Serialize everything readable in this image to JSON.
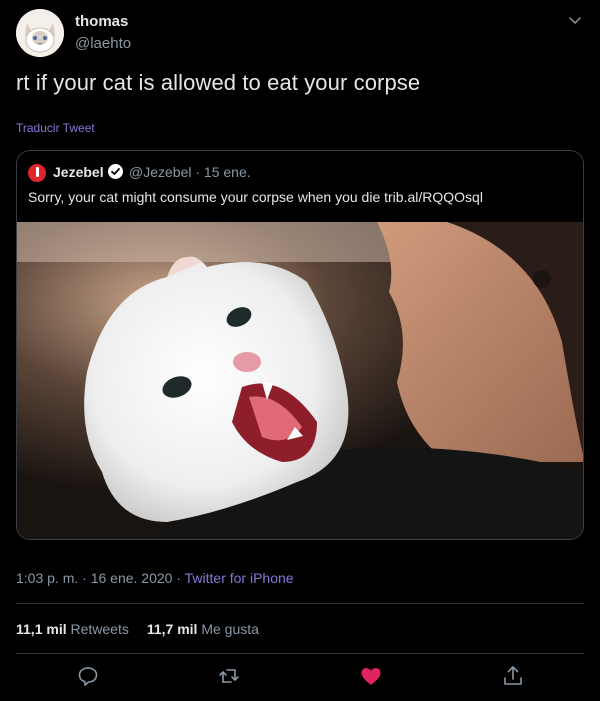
{
  "author": {
    "name": "thomas",
    "handle": "@laehto",
    "avatar_icon": "cat-avatar"
  },
  "tweet": {
    "text": "rt if your cat is allowed to eat your corpse",
    "translate_label": "Traducir Tweet"
  },
  "quoted": {
    "name": "Jezebel",
    "verified": true,
    "handle_date": "@Jezebel · 15 ene.",
    "text": "Sorry, your cat might consume your corpse when you die trib.al/RQQOsql",
    "media_icon": "cat-photo"
  },
  "meta": {
    "datetime": "1:03 p. m. · 16 ene. 2020 · ",
    "source": "Twitter for iPhone"
  },
  "stats": {
    "retweets_count": "11,1 mil",
    "retweets_label": "Retweets",
    "likes_count": "11,7 mil",
    "likes_label": "Me gusta"
  },
  "colors": {
    "background": "#000000",
    "accent": "#8b76d8",
    "like": "#e0245e",
    "brand_logo": "#e0242a",
    "verified": "#ffffff"
  }
}
